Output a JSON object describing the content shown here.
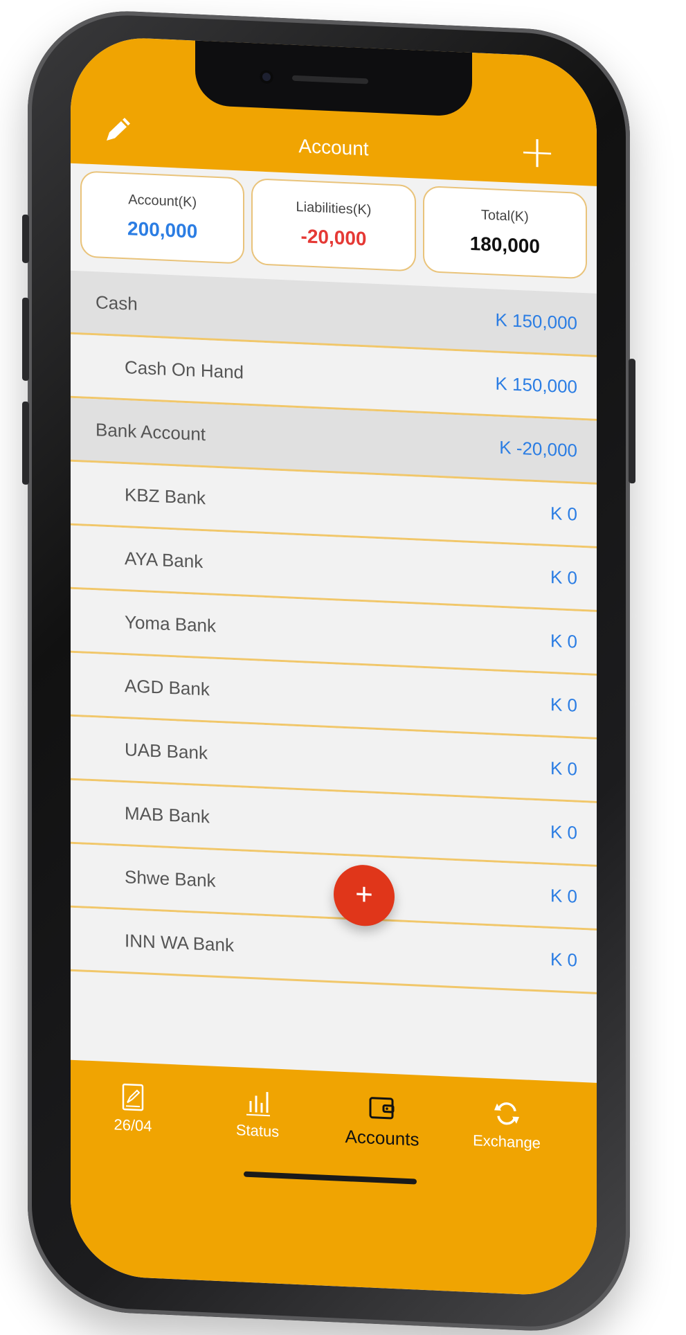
{
  "header": {
    "title": "Account"
  },
  "summary": [
    {
      "label": "Account(K)",
      "value": "200,000",
      "color": "#2b7de3"
    },
    {
      "label": "Liabilities(K)",
      "value": "-20,000",
      "color": "#e53935"
    },
    {
      "label": "Total(K)",
      "value": "180,000",
      "color": "#111111"
    }
  ],
  "accounts": [
    {
      "label": "Cash",
      "value": "K 150,000",
      "type": "group"
    },
    {
      "label": "Cash On Hand",
      "value": "K 150,000",
      "type": "item"
    },
    {
      "label": "Bank Account",
      "value": "K -20,000",
      "type": "group"
    },
    {
      "label": "KBZ Bank",
      "value": "K 0",
      "type": "item"
    },
    {
      "label": "AYA Bank",
      "value": "K 0",
      "type": "item"
    },
    {
      "label": "Yoma Bank",
      "value": "K 0",
      "type": "item"
    },
    {
      "label": "AGD Bank",
      "value": "K 0",
      "type": "item"
    },
    {
      "label": "UAB Bank",
      "value": "K 0",
      "type": "item"
    },
    {
      "label": "MAB Bank",
      "value": "K 0",
      "type": "item"
    },
    {
      "label": "Shwe Bank",
      "value": "K 0",
      "type": "item"
    },
    {
      "label": "INN WA Bank",
      "value": "K 0",
      "type": "item"
    }
  ],
  "fab": {
    "label": "+"
  },
  "tabs": [
    {
      "label": "26/04",
      "icon": "notebook-pen-icon"
    },
    {
      "label": "Status",
      "icon": "bar-chart-icon"
    },
    {
      "label": "Accounts",
      "icon": "wallet-icon",
      "active": true
    },
    {
      "label": "Exchange",
      "icon": "refresh-icon"
    }
  ],
  "colors": {
    "accent": "#f0a402",
    "fab": "#e0361a",
    "positive": "#2b7de3",
    "negative": "#e53935"
  }
}
